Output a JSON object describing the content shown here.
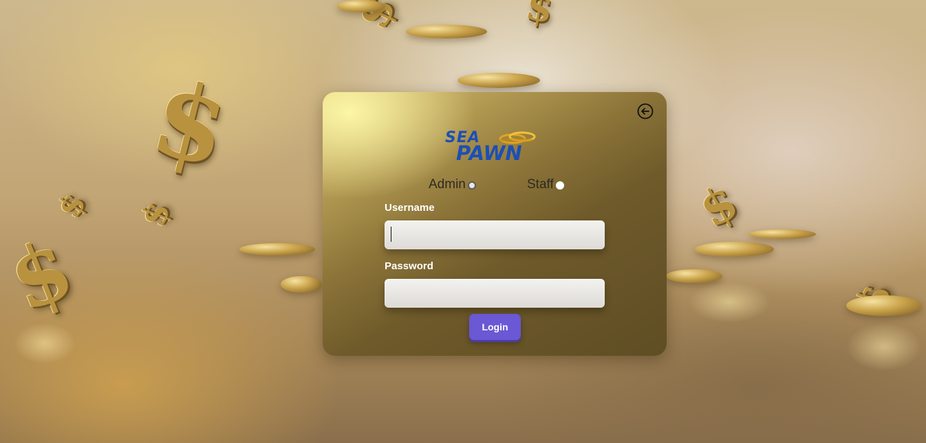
{
  "brand": {
    "logo_line1": "SEA",
    "logo_line2": "PAWN"
  },
  "header": {
    "back_icon": "arrow-left-circle-icon"
  },
  "roles": {
    "admin_label": "Admin",
    "staff_label": "Staff",
    "selected": "Admin"
  },
  "form": {
    "username_label": "Username",
    "username_value": "",
    "password_label": "Password",
    "password_value": "",
    "login_label": "Login"
  },
  "colors": {
    "brand_blue": "#1c4fb5",
    "login_button": "#6a58d4",
    "card_gold": "#8b7338"
  },
  "background": {
    "icon": "gold-dollar-signs-and-coins"
  }
}
